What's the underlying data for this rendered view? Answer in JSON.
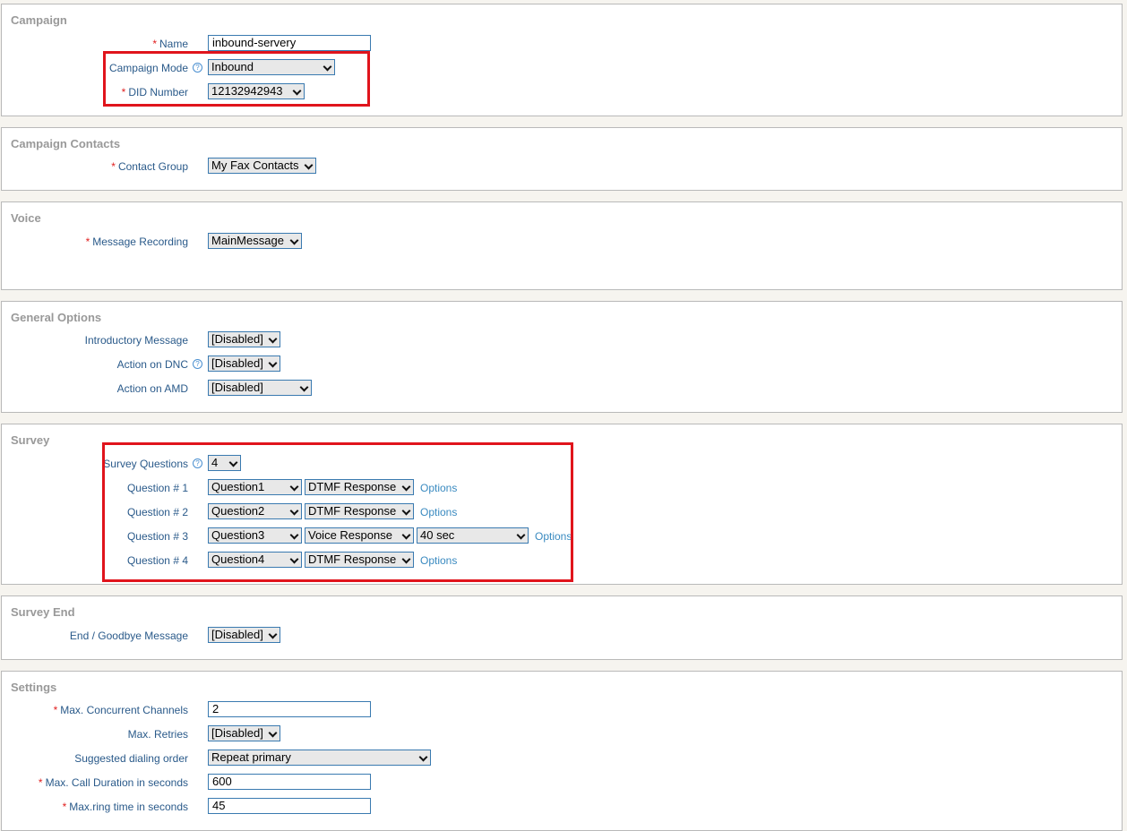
{
  "campaign": {
    "legend": "Campaign",
    "name_label": "Name",
    "name_value": "inbound-servery",
    "mode_label": "Campaign Mode",
    "mode_value": "Inbound",
    "did_label": "DID Number",
    "did_value": "12132942943"
  },
  "contacts": {
    "legend": "Campaign Contacts",
    "group_label": "Contact Group",
    "group_value": "My Fax Contacts"
  },
  "voice": {
    "legend": "Voice",
    "recording_label": "Message Recording",
    "recording_value": "MainMessage"
  },
  "general": {
    "legend": "General Options",
    "intro_label": "Introductory Message",
    "intro_value": "[Disabled]",
    "dnc_label": "Action on DNC",
    "dnc_value": "[Disabled]",
    "amd_label": "Action on AMD",
    "amd_value": "[Disabled]"
  },
  "survey": {
    "legend": "Survey",
    "questions_label": "Survey Questions",
    "questions_value": "4",
    "options_label": "Options",
    "rows": [
      {
        "label": "Question # 1",
        "question": "Question1",
        "response": "DTMF Response"
      },
      {
        "label": "Question # 2",
        "question": "Question2",
        "response": "DTMF Response"
      },
      {
        "label": "Question # 3",
        "question": "Question3",
        "response": "Voice Response",
        "duration": "40 sec"
      },
      {
        "label": "Question # 4",
        "question": "Question4",
        "response": "DTMF Response"
      }
    ]
  },
  "survey_end": {
    "legend": "Survey End",
    "goodbye_label": "End / Goodbye Message",
    "goodbye_value": "[Disabled]"
  },
  "settings": {
    "legend": "Settings",
    "channels_label": "Max. Concurrent Channels",
    "channels_value": "2",
    "retries_label": "Max. Retries",
    "retries_value": "[Disabled]",
    "order_label": "Suggested dialing order",
    "order_value": "Repeat primary",
    "duration_label": "Max. Call Duration in seconds",
    "duration_value": "600",
    "ring_label": "Max.ring time in seconds",
    "ring_value": "45"
  },
  "required_mark": "*",
  "help_glyph": "?",
  "colors": {
    "highlight": "#e0141c",
    "label": "#2a5a8a",
    "link": "#3a8ac0"
  }
}
